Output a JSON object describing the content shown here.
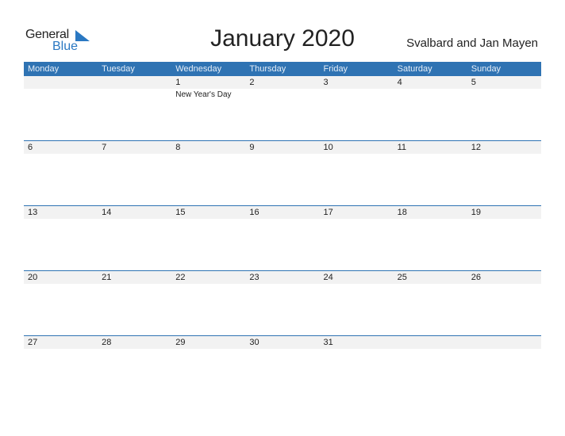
{
  "logo": {
    "word1": "General",
    "word2": "Blue"
  },
  "title": "January 2020",
  "country": "Svalbard and Jan Mayen",
  "colors": {
    "header": "#2f73b3",
    "accent": "#2a78c2",
    "strip": "#f2f2f2"
  },
  "weekdays": [
    "Monday",
    "Tuesday",
    "Wednesday",
    "Thursday",
    "Friday",
    "Saturday",
    "Sunday"
  ],
  "weeks": [
    {
      "days": [
        "",
        "",
        "1",
        "2",
        "3",
        "4",
        "5"
      ],
      "events": [
        "",
        "",
        "New Year's Day",
        "",
        "",
        "",
        ""
      ]
    },
    {
      "days": [
        "6",
        "7",
        "8",
        "9",
        "10",
        "11",
        "12"
      ],
      "events": [
        "",
        "",
        "",
        "",
        "",
        "",
        ""
      ]
    },
    {
      "days": [
        "13",
        "14",
        "15",
        "16",
        "17",
        "18",
        "19"
      ],
      "events": [
        "",
        "",
        "",
        "",
        "",
        "",
        ""
      ]
    },
    {
      "days": [
        "20",
        "21",
        "22",
        "23",
        "24",
        "25",
        "26"
      ],
      "events": [
        "",
        "",
        "",
        "",
        "",
        "",
        ""
      ]
    },
    {
      "days": [
        "27",
        "28",
        "29",
        "30",
        "31",
        "",
        ""
      ],
      "events": [
        "",
        "",
        "",
        "",
        "",
        "",
        ""
      ]
    }
  ]
}
